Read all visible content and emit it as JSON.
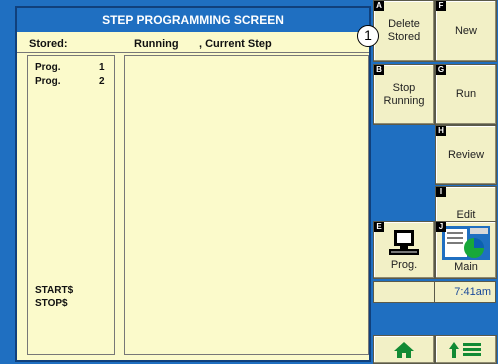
{
  "screen": {
    "title": "STEP PROGRAMMING SCREEN"
  },
  "headers": {
    "stored": "Stored:",
    "running": "Running",
    "current_step": ", Current Step"
  },
  "stored_programs": [
    {
      "label": "Prog.",
      "number": "1"
    },
    {
      "label": "Prog.",
      "number": "2"
    }
  ],
  "footer_items": [
    "START$",
    "STOP$"
  ],
  "buttons": {
    "delete_stored": {
      "key": "A",
      "label_line1": "Delete",
      "label_line2": "Stored"
    },
    "new": {
      "key": "F",
      "label": "New"
    },
    "stop_running": {
      "key": "B",
      "label_line1": "Stop",
      "label_line2": "Running"
    },
    "run": {
      "key": "G",
      "label": "Run"
    },
    "review": {
      "key": "H",
      "label": "Review"
    },
    "edit": {
      "key": "I",
      "label": "Edit"
    },
    "prog": {
      "key": "E",
      "label": "Prog."
    },
    "main": {
      "key": "J",
      "label": "Main"
    }
  },
  "callout": "1",
  "clock": "7:41am",
  "colors": {
    "background": "#1f6fc1",
    "panel": "#fbfacb",
    "button": "#f2f0c6",
    "clock_text": "#1a4a9a"
  }
}
